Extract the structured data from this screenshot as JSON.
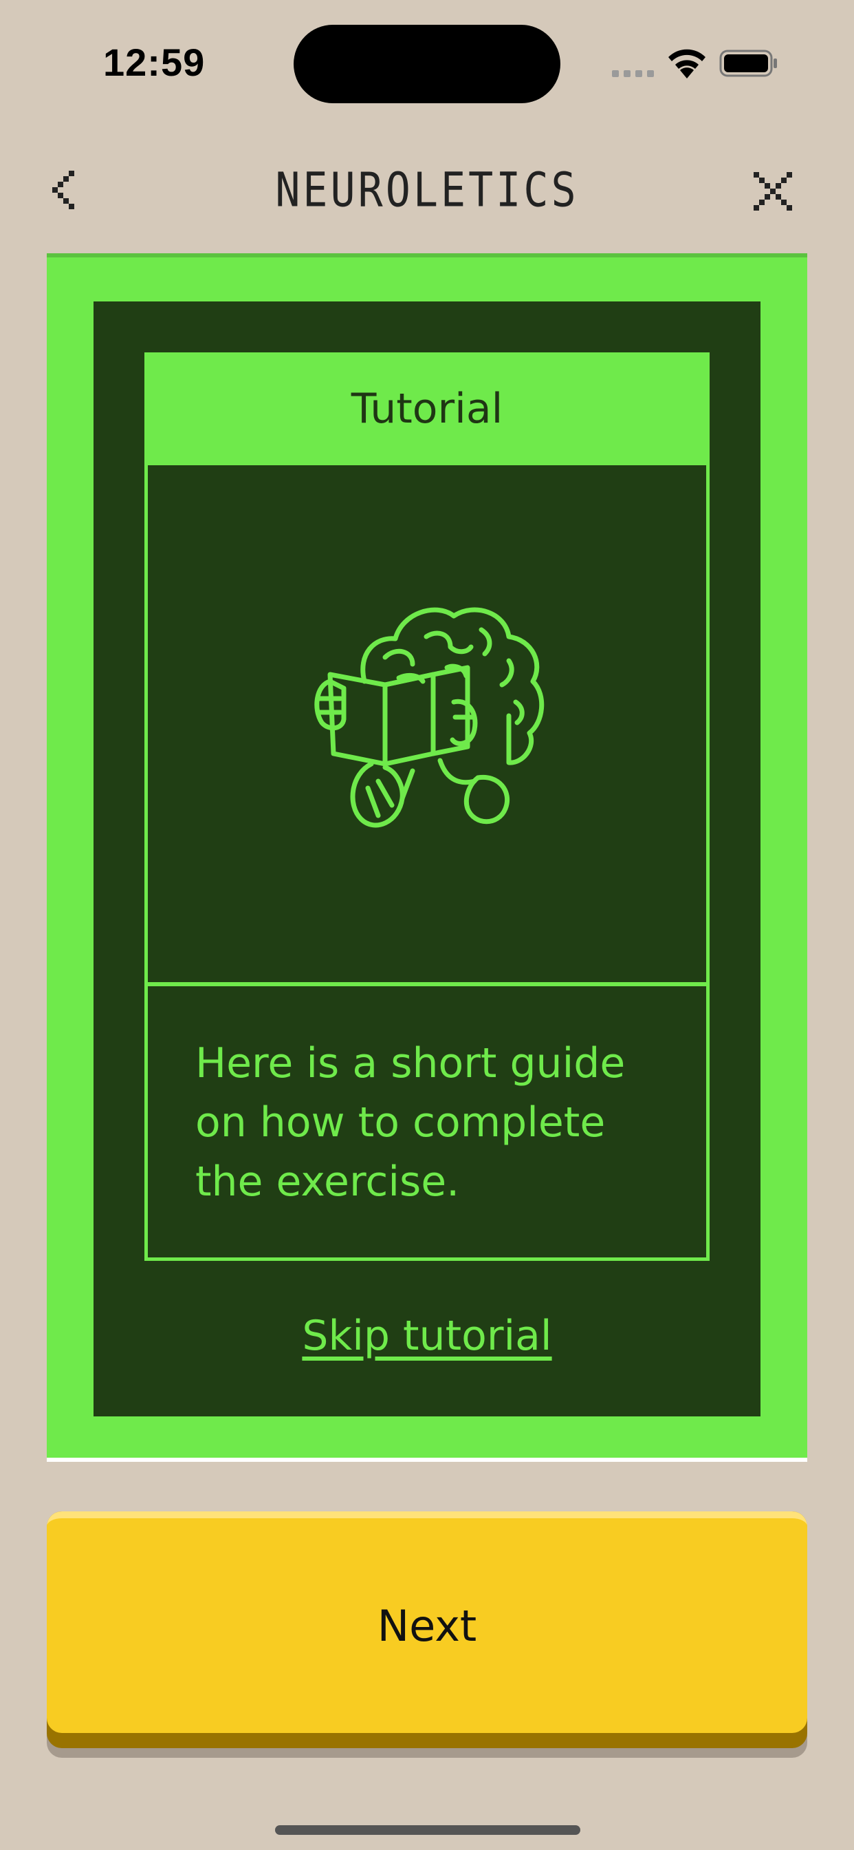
{
  "status_bar": {
    "time": "12:59"
  },
  "nav": {
    "title": "NEUROLETICS",
    "back_icon": "chevron-left-icon",
    "close_icon": "close-icon"
  },
  "card": {
    "header": "Tutorial",
    "illustration": "brain-reading-book-icon",
    "description": "Here is a short guide on how to complete the exercise.",
    "skip_label": "Skip tutorial"
  },
  "footer": {
    "next_label": "Next"
  },
  "colors": {
    "background": "#d5c9ba",
    "accent_green": "#6fea4b",
    "dark_green": "#203e14",
    "button_yellow": "#f8cc22"
  }
}
